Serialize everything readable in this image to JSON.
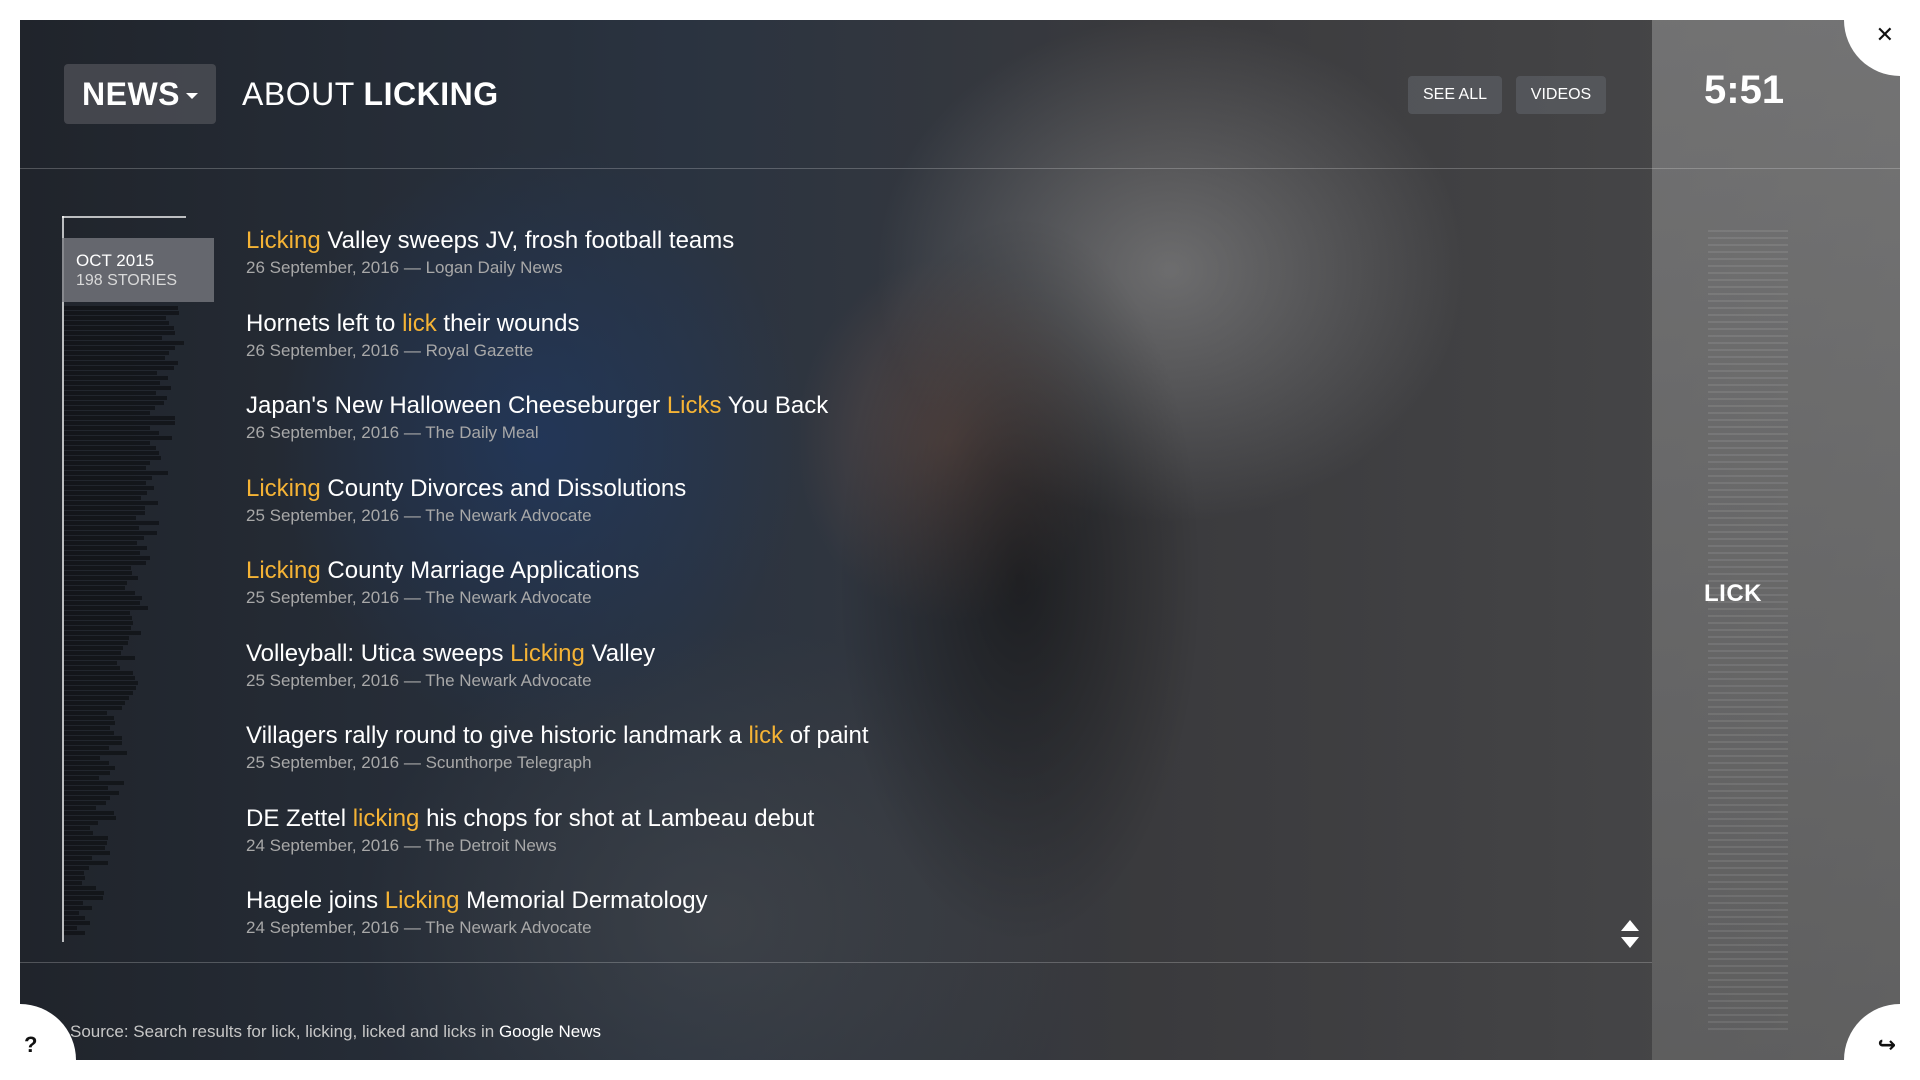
{
  "header": {
    "section_label": "NEWS",
    "title_prefix": "ABOUT",
    "title_keyword": "LICKING",
    "see_all_label": "SEE ALL",
    "videos_label": "VIDEOS"
  },
  "clock": "5:51",
  "side_word": "LICK",
  "timeline": {
    "month": "OCT 2015",
    "stories": "198 STORIES"
  },
  "articles": [
    {
      "pre": "",
      "hl": "Licking",
      "post": " Valley sweeps JV, frosh football teams",
      "meta": "26 September, 2016 — Logan Daily News"
    },
    {
      "pre": "Hornets left to ",
      "hl": "lick",
      "post": " their wounds",
      "meta": "26 September, 2016 — Royal Gazette"
    },
    {
      "pre": "Japan's New Halloween Cheeseburger ",
      "hl": "Licks",
      "post": " You Back",
      "meta": "26 September, 2016 — The Daily Meal"
    },
    {
      "pre": "",
      "hl": "Licking",
      "post": " County Divorces and Dissolutions",
      "meta": "25 September, 2016 — The Newark Advocate"
    },
    {
      "pre": "",
      "hl": "Licking",
      "post": " County Marriage Applications",
      "meta": "25 September, 2016 — The Newark Advocate"
    },
    {
      "pre": "Volleyball: Utica sweeps ",
      "hl": "Licking",
      "post": " Valley",
      "meta": "25 September, 2016 — The Newark Advocate"
    },
    {
      "pre": "Villagers rally round to give historic landmark a ",
      "hl": "lick",
      "post": " of paint",
      "meta": "25 September, 2016 — Scunthorpe Telegraph"
    },
    {
      "pre": "DE Zettel ",
      "hl": "licking",
      "post": " his chops for shot at Lambeau debut",
      "meta": "24 September, 2016 — The Detroit News"
    },
    {
      "pre": "Hagele joins ",
      "hl": "Licking",
      "post": " Memorial Dermatology",
      "meta": "24 September, 2016 — The Newark Advocate"
    }
  ],
  "footer": {
    "prefix": "Source: Search results for lick, licking, licked and licks in ",
    "source": "Google News"
  },
  "corners": {
    "close": "✕",
    "help": "?",
    "share": "↪"
  },
  "colors": {
    "highlight": "#f5b335",
    "text": "#ffffff",
    "meta": "#a8a8a8"
  }
}
